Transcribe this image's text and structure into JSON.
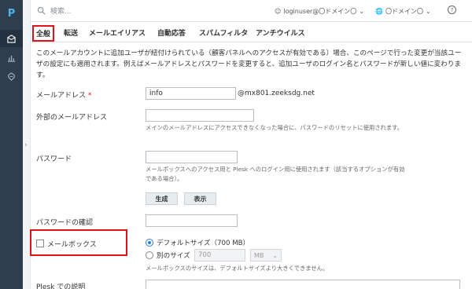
{
  "app": {
    "logo": "P"
  },
  "topbar": {
    "search_placeholder": "検索...",
    "user": "loginuser@〇ドメイン〇",
    "domain": "〇ドメイン〇",
    "help": "?"
  },
  "tabs": [
    {
      "label": "全般",
      "active": true
    },
    {
      "label": "転送"
    },
    {
      "label": "メールエイリアス"
    },
    {
      "label": "自動応答"
    },
    {
      "label": "スパムフィルタ"
    },
    {
      "label": "アンチウイルス"
    }
  ],
  "intro": "このメールアカウントに追加ユーザが紐付けられている（顧客パネルへのアクセスが有効である）場合、このページで行った変更が当該ユーザの設定にも適用されます。例えばメールアドレスとパスワードを変更すると、追加ユーザのログイン名とパスワードが新しい値に変わります。",
  "form": {
    "email_label": "メールアドレス",
    "email_required": "*",
    "email_value": "info",
    "email_suffix": "@mx801.zeeksdg.net",
    "external_label": "外部のメールアドレス",
    "external_value": "",
    "external_hint": "メインのメールアドレスにアクセスできなくなった場合に、パスワードのリセットに使用されます。",
    "password_label": "パスワード",
    "password_value": "",
    "password_hint": "メールボックスへのアクセス用と Plesk へのログイン用に使用されます（該当するオプションが有効である場合）。",
    "generate_button": "生成",
    "show_button": "表示",
    "confirm_label": "パスワードの確認",
    "confirm_value": "",
    "mailbox_label": "メールボックス",
    "mailbox_checked": false,
    "size_default_label": "デフォルトサイズ（700 MB）",
    "size_custom_label": "別のサイズ",
    "size_custom_value": "700",
    "size_unit": "MB",
    "size_hint": "メールボックスのサイズは、デフォルトサイズより大きくできません。",
    "description_label": "Plesk での説明"
  },
  "colors": {
    "highlight": "#e0121b",
    "sidebar": "#2f3e4e",
    "accent": "#2b7fd7"
  }
}
